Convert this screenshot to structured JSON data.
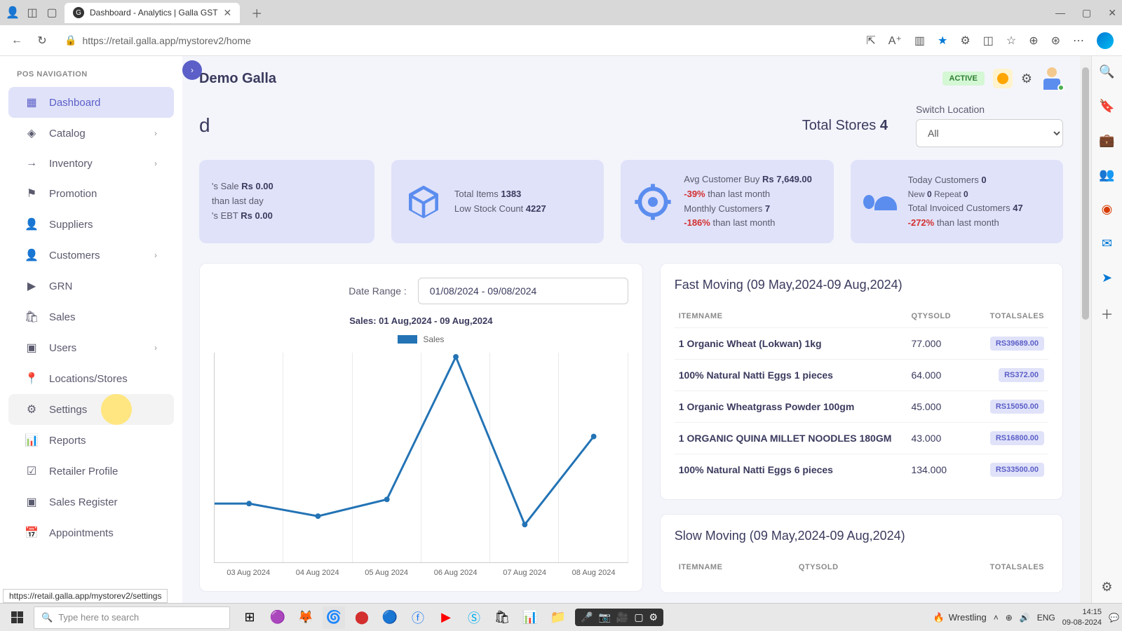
{
  "browser": {
    "tab_title": "Dashboard - Analytics | Galla GST",
    "url": "https://retail.galla.app/mystorev2/home",
    "status_url": "https://retail.galla.app/mystorev2/settings"
  },
  "sidebar": {
    "header": "POS NAVIGATION",
    "items": [
      {
        "label": "Dashboard"
      },
      {
        "label": "Catalog"
      },
      {
        "label": "Inventory"
      },
      {
        "label": "Promotion"
      },
      {
        "label": "Suppliers"
      },
      {
        "label": "Customers"
      },
      {
        "label": "GRN"
      },
      {
        "label": "Sales"
      },
      {
        "label": "Users"
      },
      {
        "label": "Locations/Stores"
      },
      {
        "label": "Settings"
      },
      {
        "label": "Reports"
      },
      {
        "label": "Retailer Profile"
      },
      {
        "label": "Sales Register"
      },
      {
        "label": "Appointments"
      }
    ]
  },
  "header": {
    "store_name": "Demo Galla",
    "status": "ACTIVE",
    "dashboard_partial": "d",
    "total_stores_label": "Total Stores ",
    "total_stores_value": "4",
    "switch_label": "Switch Location",
    "switch_value": "All"
  },
  "stats": {
    "card1": {
      "l1a": "'s Sale ",
      "l1b": "Rs 0.00",
      "l2": "than last day",
      "l3a": "'s EBT ",
      "l3b": "Rs 0.00"
    },
    "card2": {
      "l1a": "Total Items ",
      "l1b": "1383",
      "l2a": "Low Stock Count ",
      "l2b": "4227"
    },
    "card3": {
      "l1a": "Avg Customer Buy ",
      "l1b": "Rs 7,649.00",
      "l2a": "-39%",
      "l2b": " than last month",
      "l3a": "Monthly Customers ",
      "l3b": "7",
      "l4a": "-186%",
      "l4b": " than last month"
    },
    "card4": {
      "l1a": "Today Customers ",
      "l1b": "0",
      "l2a": "New ",
      "l2b": "0",
      "l2c": "  Repeat ",
      "l2d": "0",
      "l3a": "Total Invoiced Customers ",
      "l3b": "47",
      "l4a": "-272%",
      "l4b": " than last month"
    }
  },
  "chart": {
    "date_label": "Date Range :",
    "date_value": "01/08/2024 - 09/08/2024",
    "title": "Sales: 01 Aug,2024 - 09 Aug,2024",
    "legend": "Sales"
  },
  "chart_data": {
    "type": "line",
    "title": "Sales: 01 Aug,2024 - 09 Aug,2024",
    "xlabel": "",
    "ylabel": "",
    "categories": [
      "03 Aug 2024",
      "04 Aug 2024",
      "05 Aug 2024",
      "06 Aug 2024",
      "07 Aug 2024",
      "08 Aug 2024"
    ],
    "series": [
      {
        "name": "Sales",
        "values_relative": [
          0.28,
          0.22,
          0.3,
          0.98,
          0.18,
          0.6
        ]
      }
    ],
    "note": "Y-axis tick values not visible; values_relative are normalized estimates read from the line height within the plot area."
  },
  "fast": {
    "title": "Fast Moving (09 May,2024-09 Aug,2024)",
    "headers": {
      "c1": "ITEMNAME",
      "c2": "QTYSOLD",
      "c3": "TOTALSALES"
    },
    "rows": [
      {
        "name": "1 Organic Wheat (Lokwan) 1kg",
        "qty": "77.000",
        "total": "RS39689.00"
      },
      {
        "name": "100% Natural Natti Eggs 1 pieces",
        "qty": "64.000",
        "total": "RS372.00"
      },
      {
        "name": "1 Organic Wheatgrass Powder 100gm",
        "qty": "45.000",
        "total": "RS15050.00"
      },
      {
        "name": "1 ORGANIC QUINA MILLET NOODLES 180GM",
        "qty": "43.000",
        "total": "RS16800.00"
      },
      {
        "name": "100% Natural Natti Eggs 6 pieces",
        "qty": "134.000",
        "total": "RS33500.00"
      }
    ]
  },
  "slow": {
    "title": "Slow Moving (09 May,2024-09 Aug,2024)",
    "headers": {
      "c1": "ITEMNAME",
      "c2": "QTYSOLD",
      "c3": "TOTALSALES"
    }
  },
  "taskbar": {
    "search_placeholder": "Type here to search",
    "weather": "Wrestling",
    "lang": "ENG",
    "time": "14:15",
    "date": "09-08-2024"
  }
}
